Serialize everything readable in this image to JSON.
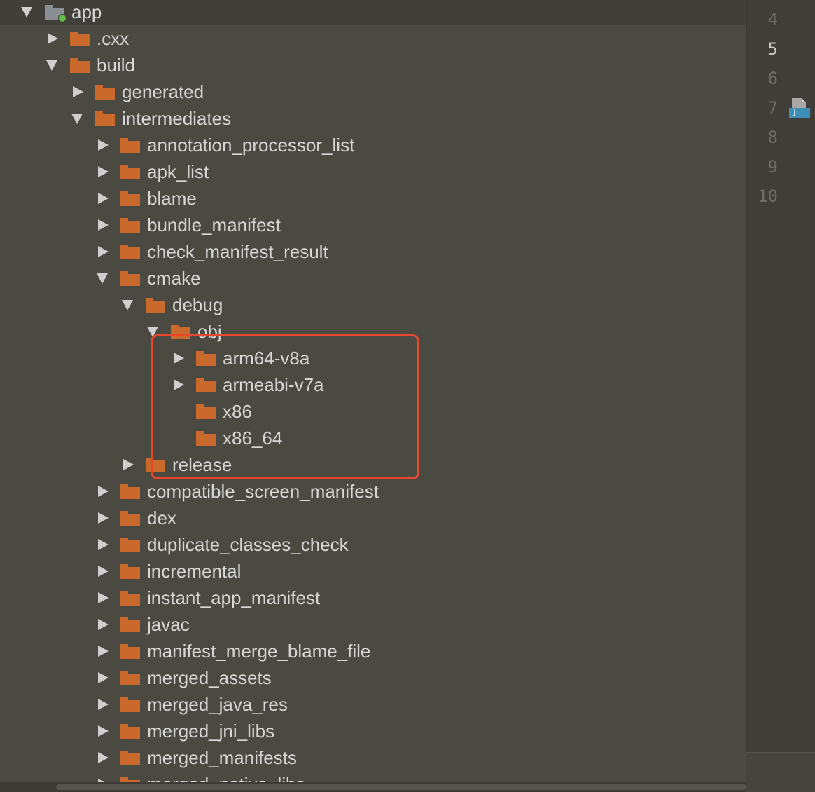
{
  "project_tree": {
    "nodes": [
      {
        "label": "app",
        "expanded": true,
        "is_module": true
      },
      {
        "label": ".cxx",
        "expanded": false
      },
      {
        "label": "build",
        "expanded": true
      },
      {
        "label": "generated",
        "expanded": false
      },
      {
        "label": "intermediates",
        "expanded": true
      },
      {
        "label": "annotation_processor_list",
        "expanded": false
      },
      {
        "label": "apk_list",
        "expanded": false
      },
      {
        "label": "blame",
        "expanded": false
      },
      {
        "label": "bundle_manifest",
        "expanded": false
      },
      {
        "label": "check_manifest_result",
        "expanded": false
      },
      {
        "label": "cmake",
        "expanded": true
      },
      {
        "label": "debug",
        "expanded": true
      },
      {
        "label": "obj",
        "expanded": true
      },
      {
        "label": "arm64-v8a",
        "expanded": false
      },
      {
        "label": "armeabi-v7a",
        "expanded": false
      },
      {
        "label": "x86",
        "expanded": null
      },
      {
        "label": "x86_64",
        "expanded": null
      },
      {
        "label": "release",
        "expanded": false
      },
      {
        "label": "compatible_screen_manifest",
        "expanded": false
      },
      {
        "label": "dex",
        "expanded": false
      },
      {
        "label": "duplicate_classes_check",
        "expanded": false
      },
      {
        "label": "incremental",
        "expanded": false
      },
      {
        "label": "instant_app_manifest",
        "expanded": false
      },
      {
        "label": "javac",
        "expanded": false
      },
      {
        "label": "manifest_merge_blame_file",
        "expanded": false
      },
      {
        "label": "merged_assets",
        "expanded": false
      },
      {
        "label": "merged_java_res",
        "expanded": false
      },
      {
        "label": "merged_jni_libs",
        "expanded": false
      },
      {
        "label": "merged_manifests",
        "expanded": false
      },
      {
        "label": "merged_native_libs",
        "expanded": false
      }
    ]
  },
  "gutter": {
    "line_numbers": [
      "4",
      "5",
      "6",
      "7",
      "8",
      "9",
      "10"
    ],
    "current_line": "5"
  },
  "colors": {
    "folder": "#c9692c",
    "annotation_box": "#e8472e",
    "background": "#4b4a42"
  }
}
